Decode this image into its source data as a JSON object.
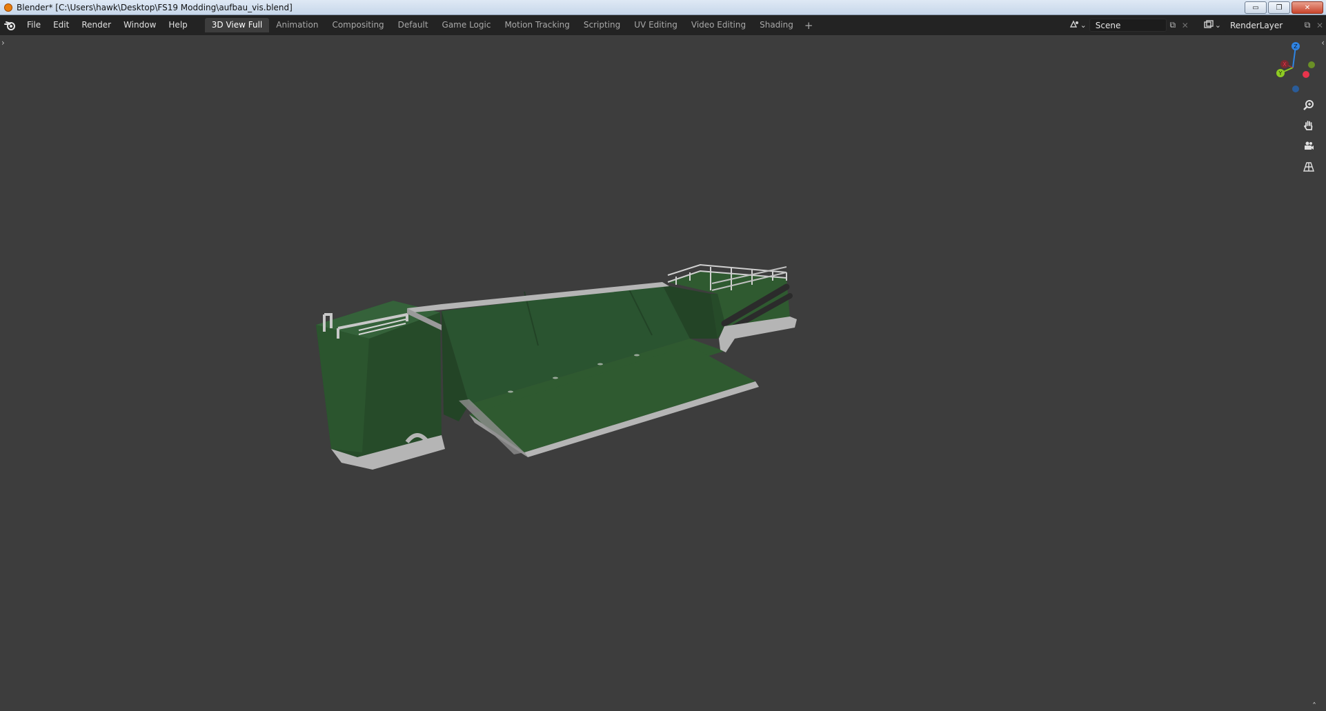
{
  "window": {
    "title": "Blender* [C:\\Users\\hawk\\Desktop\\FS19 Modding\\aufbau_vis.blend]",
    "minimize_label": "▭",
    "restore_label": "❐",
    "close_label": "✕"
  },
  "menu": [
    "File",
    "Edit",
    "Render",
    "Window",
    "Help"
  ],
  "workspaces": {
    "tabs": [
      "3D View Full",
      "Animation",
      "Compositing",
      "Default",
      "Game Logic",
      "Motion Tracking",
      "Scripting",
      "UV Editing",
      "Video Editing",
      "Shading"
    ],
    "active": "3D View Full",
    "add_label": "+"
  },
  "scene": {
    "name": "Scene"
  },
  "view_layer": {
    "name": "RenderLayer"
  },
  "gizmo": {
    "x_label": "X",
    "y_label": "Y",
    "z_label": "Z",
    "x_color": "#e8344c",
    "y_color": "#8ecb23",
    "z_color": "#2f84e3"
  },
  "viewport": {
    "background": "#3d3d3d",
    "tools": [
      "zoom-icon",
      "hand-pan-icon",
      "camera-icon",
      "perspective-grid-icon"
    ]
  },
  "model_colors": {
    "body": "#2f5a30",
    "body_dark": "#234426",
    "trim": "#b5b5b5",
    "pipe": "#2b2b2b"
  }
}
